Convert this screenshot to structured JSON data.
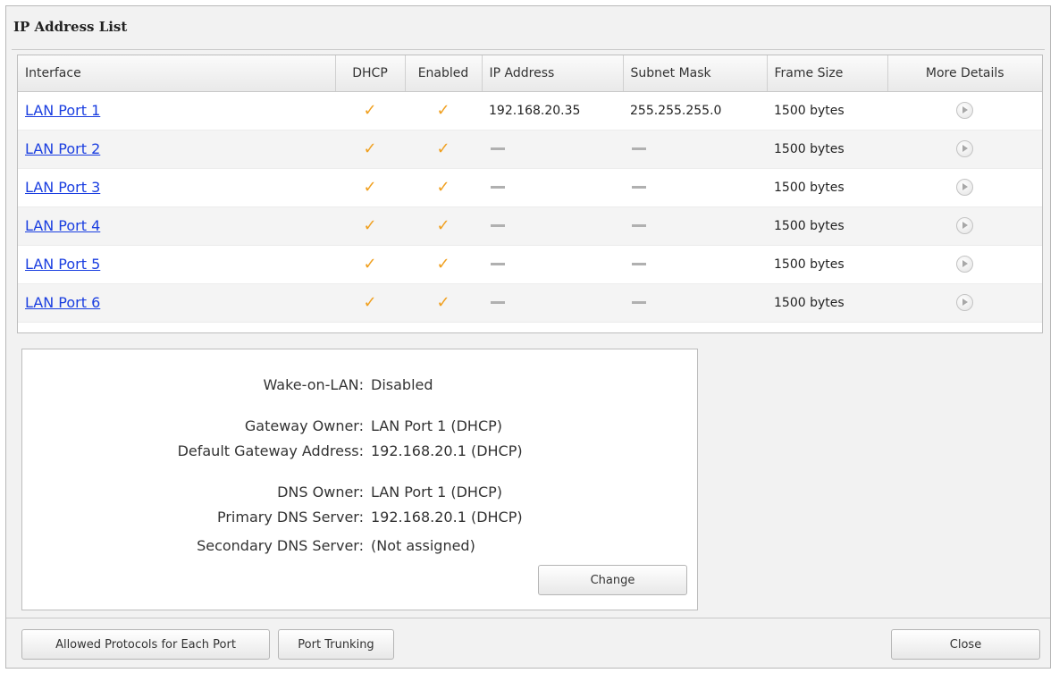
{
  "dialog": {
    "title": "IP Address List"
  },
  "table": {
    "headers": [
      "Interface",
      "DHCP",
      "Enabled",
      "IP Address",
      "Subnet Mask",
      "Frame Size",
      "More Details"
    ],
    "rows": [
      {
        "interface": "LAN Port 1",
        "dhcp": "✓",
        "enabled": "✓",
        "ip": "192.168.20.35",
        "subnet": "255.255.255.0",
        "frame": "1500 bytes"
      },
      {
        "interface": "LAN Port 2",
        "dhcp": "✓",
        "enabled": "✓",
        "ip": "",
        "subnet": "",
        "frame": "1500 bytes"
      },
      {
        "interface": "LAN Port 3",
        "dhcp": "✓",
        "enabled": "✓",
        "ip": "",
        "subnet": "",
        "frame": "1500 bytes"
      },
      {
        "interface": "LAN Port 4",
        "dhcp": "✓",
        "enabled": "✓",
        "ip": "",
        "subnet": "",
        "frame": "1500 bytes"
      },
      {
        "interface": "LAN Port 5",
        "dhcp": "✓",
        "enabled": "✓",
        "ip": "",
        "subnet": "",
        "frame": "1500 bytes"
      },
      {
        "interface": "LAN Port 6",
        "dhcp": "✓",
        "enabled": "✓",
        "ip": "",
        "subnet": "",
        "frame": "1500 bytes"
      }
    ]
  },
  "network_info": {
    "wake_on_lan": {
      "label": "Wake-on-LAN:",
      "value": "Disabled"
    },
    "gateway_owner": {
      "label": "Gateway Owner:",
      "value": "LAN Port 1 (DHCP)"
    },
    "default_gateway": {
      "label": "Default Gateway Address:",
      "value": "192.168.20.1 (DHCP)"
    },
    "dns_owner": {
      "label": "DNS Owner:",
      "value": "LAN Port 1 (DHCP)"
    },
    "primary_dns": {
      "label": "Primary DNS Server:",
      "value": "192.168.20.1 (DHCP)"
    },
    "secondary_dns": {
      "label": "Secondary DNS Server:",
      "value": "(Not assigned)"
    },
    "change_label": "Change"
  },
  "footer": {
    "allowed_protocols_label": "Allowed Protocols for Each Port",
    "port_trunking_label": "Port Trunking",
    "close_label": "Close"
  },
  "colors": {
    "link": "#1a3ee0",
    "check": "#f0a020"
  },
  "icons": {
    "check": "check-icon",
    "details": "play-circle-icon",
    "empty": "dash-icon"
  }
}
